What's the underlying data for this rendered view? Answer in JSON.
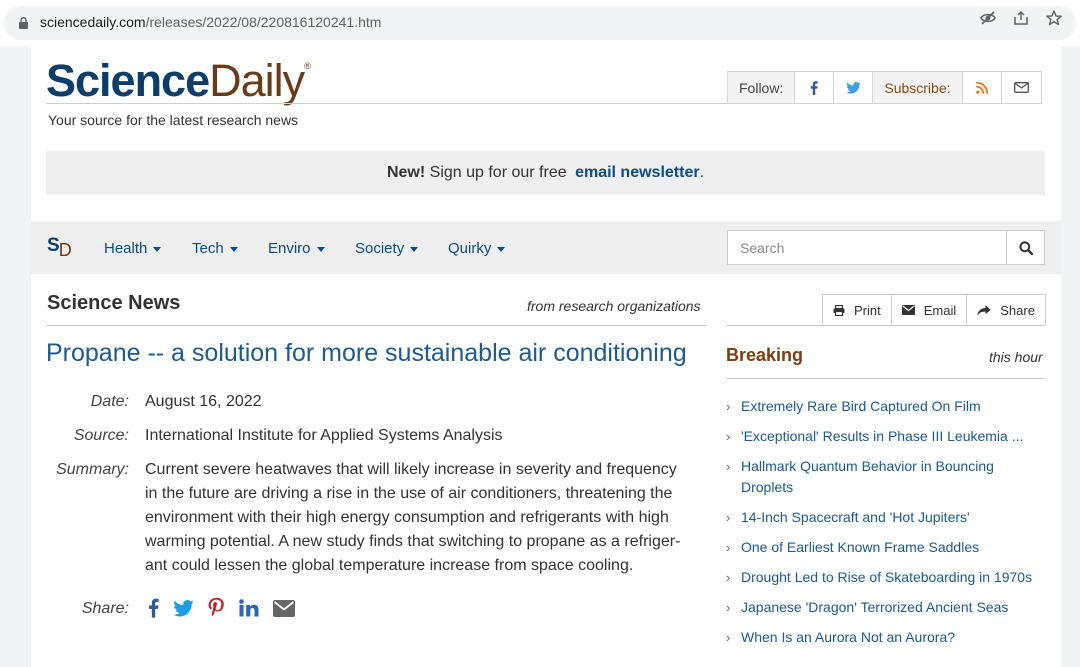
{
  "browser": {
    "url_host": "sciencedaily.com",
    "url_path": "/releases/2022/08/220816120241.htm",
    "icons": [
      "lock-icon",
      "eye-off-icon",
      "share-icon",
      "star-icon"
    ]
  },
  "header": {
    "logo_science": "Science",
    "logo_daily": "Daily",
    "logo_reg": "®",
    "tagline": "Your source for the latest research news",
    "follow_label": "Follow:",
    "subscribe_label": "Subscribe:"
  },
  "newsletter": {
    "new": "New!",
    "text": " Sign up for our free ",
    "link": "email newsletter",
    "end": "."
  },
  "nav": {
    "mark_s": "S",
    "mark_d": "D",
    "items": [
      "Health",
      "Tech",
      "Enviro",
      "Society",
      "Quirky"
    ],
    "search_placeholder": "Search"
  },
  "article": {
    "section_title": "Science News",
    "section_sub": "from research organizations",
    "headline": "Propane -- a solution for more sustainable air conditioning",
    "date_label": "Date:",
    "date": "August 16, 2022",
    "source_label": "Source:",
    "source": "International Institute for Applied Systems Analysis",
    "summary_label": "Summary:",
    "summary_lines": [
      "Current severe heatwaves that will likely increase in severity and frequency",
      "in the future are driving a rise in the use of air conditioners, threatening the",
      "environment with their high energy consumption and refrigerants with high",
      "warming potential. A new study finds that switching to propane as a refriger-",
      "ant could lessen the global temperature increase from space cooling."
    ],
    "share_label": "Share:"
  },
  "tools": {
    "print": "Print",
    "email": "Email",
    "share": "Share"
  },
  "sidebar": {
    "title": "Breaking",
    "subtitle": "this hour",
    "items": [
      [
        "Extremely Rare Bird Captured On Film"
      ],
      [
        "'Exceptional' Results in Phase III Leukemia ..."
      ],
      [
        "Hallmark Quantum Behavior in Bouncing",
        "Droplets"
      ],
      [
        "14-Inch Spacecraft and 'Hot Jupiters'"
      ],
      [
        "One of Earliest Known Frame Saddles"
      ],
      [
        "Drought Led to Rise of Skateboarding in 1970s"
      ],
      [
        "Japanese 'Dragon' Terrorized Ancient Seas"
      ],
      [
        "When Is an Aurora Not an Aurora?"
      ]
    ]
  },
  "colors": {
    "brand_blue": "#0c3d6b",
    "brand_brown": "#6b3a17",
    "link_blue": "#1c5a8f"
  }
}
